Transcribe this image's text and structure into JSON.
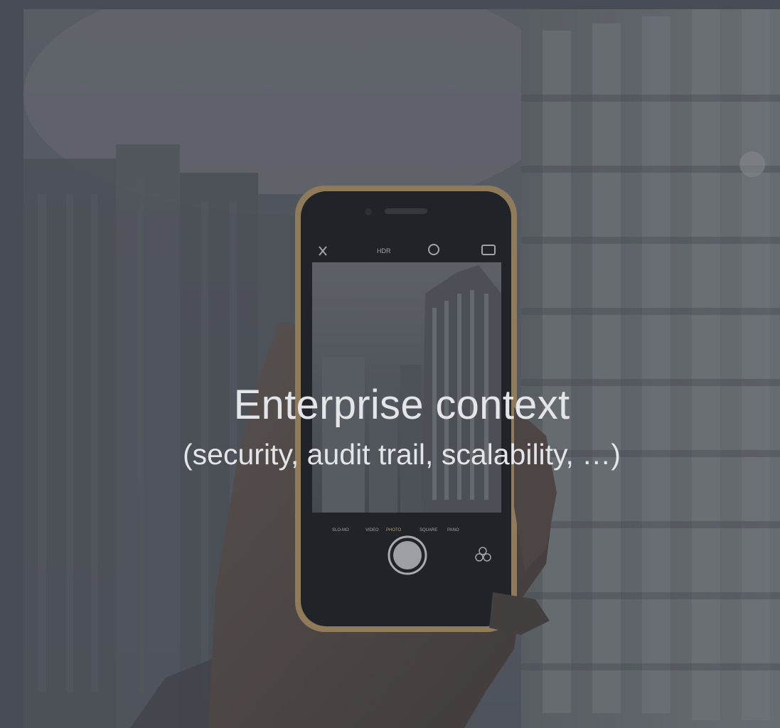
{
  "slide": {
    "title": "Enterprise context",
    "subtitle": "(security, audit trail, scalability, …)"
  },
  "photo": {
    "subject": "hand-holding-smartphone-camera-icon",
    "camera_modes": [
      "SLO-MO",
      "VIDEO",
      "PHOTO",
      "SQUARE",
      "PANO"
    ],
    "camera_top_label": "HDR"
  },
  "colors": {
    "slide_background": "#484c55",
    "text": "#e3e5e8",
    "phone_frame": "#b89a6a"
  }
}
